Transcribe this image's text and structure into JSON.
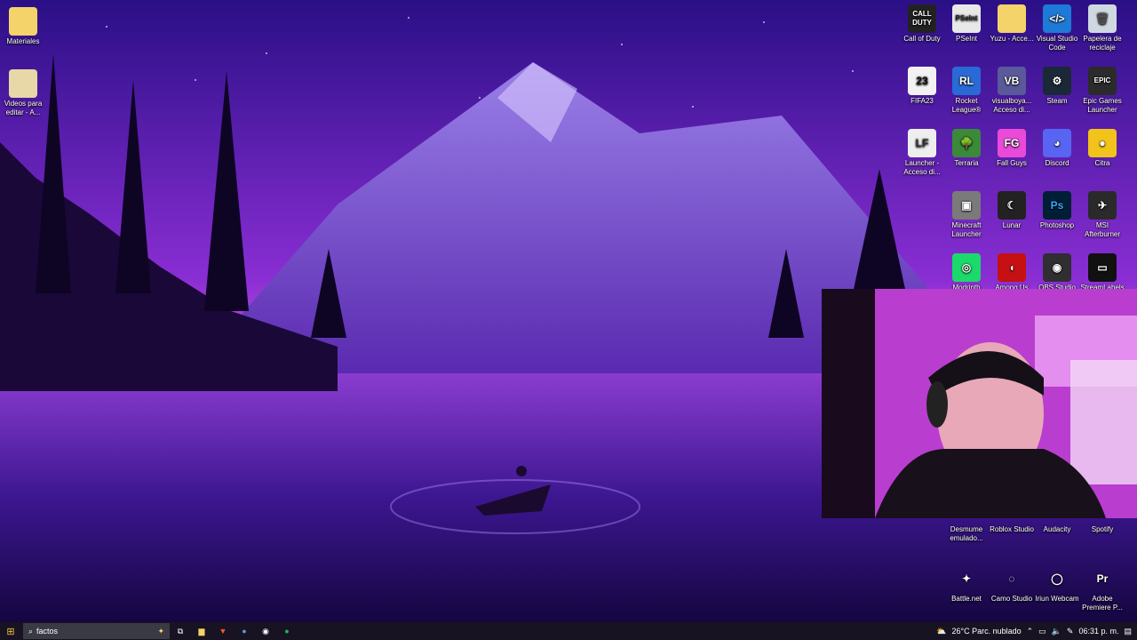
{
  "colors": {
    "accent": "#7d2fd8",
    "taskbar": "#171322"
  },
  "desktop": {
    "left_icons": [
      {
        "label": "Materiales",
        "icon": "folder-icon"
      },
      {
        "label": "Videos para editar - A...",
        "icon": "video-folder-icon"
      }
    ],
    "right_icons": [
      {
        "label": "Call of Duty",
        "icon": "call-of-duty-icon",
        "text": "CALL\nDUTY"
      },
      {
        "label": "PSeInt",
        "icon": "pseint-icon",
        "text": "PSeInt"
      },
      {
        "label": "Yuzu - Acce...",
        "icon": "folder-icon",
        "text": ""
      },
      {
        "label": "Visual Studio Code",
        "icon": "vscode-icon",
        "text": "</>"
      },
      {
        "label": "Papelera de reciclaje",
        "icon": "recycle-bin-icon",
        "text": "🗑"
      },
      {
        "label": "FIFA23",
        "icon": "fifa23-icon",
        "text": "23"
      },
      {
        "label": "Rocket League®",
        "icon": "rocket-league-icon",
        "text": "RL"
      },
      {
        "label": "visualboya... Acceso di...",
        "icon": "visualboy-icon",
        "text": "VB"
      },
      {
        "label": "Steam",
        "icon": "steam-icon",
        "text": "⚙"
      },
      {
        "label": "Epic Games Launcher",
        "icon": "epic-games-icon",
        "text": "EPIC"
      },
      {
        "label": "Launcher - Acceso di...",
        "icon": "lf-launcher-icon",
        "text": "LF"
      },
      {
        "label": "Terraria",
        "icon": "terraria-icon",
        "text": "🌳"
      },
      {
        "label": "Fall Guys",
        "icon": "fall-guys-icon",
        "text": "FG"
      },
      {
        "label": "Discord",
        "icon": "discord-icon",
        "text": "◕"
      },
      {
        "label": "Citra",
        "icon": "citra-icon",
        "text": "●"
      },
      {
        "label": "Minecraft Launcher",
        "icon": "minecraft-icon",
        "text": "▣"
      },
      {
        "label": "Lunar",
        "icon": "lunar-icon",
        "text": "☾"
      },
      {
        "label": "Photoshop",
        "icon": "photoshop-icon",
        "text": "Ps"
      },
      {
        "label": "MSI Afterburner",
        "icon": "msi-afterburner-icon",
        "text": "✈"
      },
      {
        "label": "Modrinth",
        "icon": "modrinth-icon",
        "text": "◎"
      },
      {
        "label": "Among Us",
        "icon": "among-us-icon",
        "text": "◖"
      },
      {
        "label": "OBS Studio",
        "icon": "obs-icon",
        "text": "◉"
      },
      {
        "label": "StreamLabels",
        "icon": "streamlabels-icon",
        "text": "▭"
      },
      {
        "label": "Desmume emulado...",
        "icon": "desmume-icon",
        "text": ""
      },
      {
        "label": "Roblox Studio",
        "icon": "roblox-studio-icon",
        "text": ""
      },
      {
        "label": "Audacity",
        "icon": "audacity-icon",
        "text": ""
      },
      {
        "label": "Spotify",
        "icon": "spotify-icon",
        "text": ""
      },
      {
        "label": "Battle.net",
        "icon": "battlenet-icon",
        "text": "✦"
      },
      {
        "label": "Camo Studio",
        "icon": "camo-studio-icon",
        "text": "◌"
      },
      {
        "label": "Iriun Webcam",
        "icon": "iriun-webcam-icon",
        "text": "◯"
      },
      {
        "label": "Adobe Premiere P...",
        "icon": "premiere-icon",
        "text": "Pr"
      }
    ]
  },
  "taskbar": {
    "search_value": "factos",
    "weather": "26°C  Parc. nublado",
    "clock": "06:31 p. m."
  }
}
